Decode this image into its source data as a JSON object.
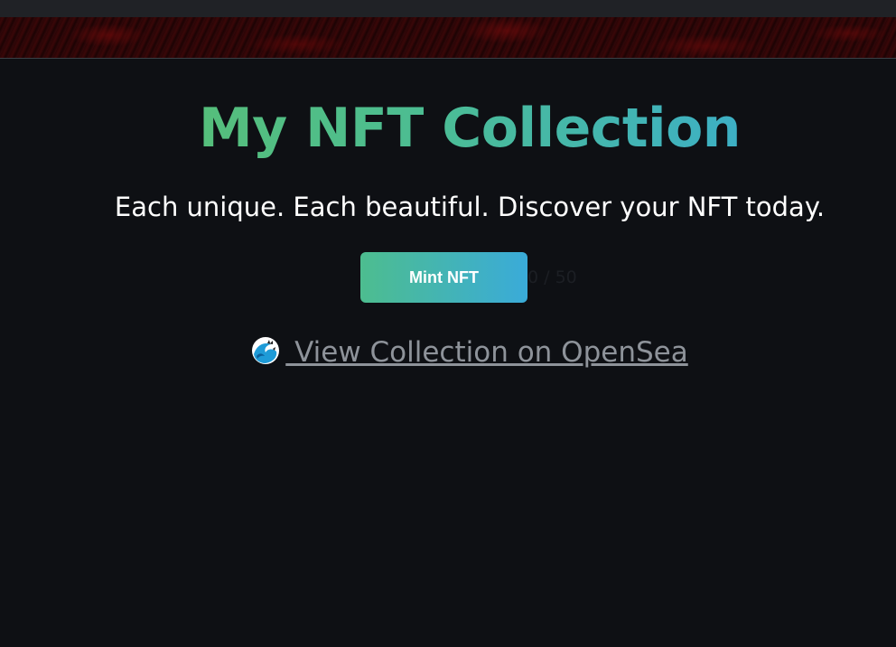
{
  "header": {
    "title": "My NFT Collection",
    "subtitle": "Each unique. Each beautiful. Discover your NFT today."
  },
  "mint": {
    "button_label": "Mint NFT",
    "count_text": "0 / 50"
  },
  "opensea": {
    "icon": "wave-icon",
    "link_text": " View Collection on OpenSea"
  },
  "colors": {
    "background": "#0e1014",
    "gradient_start": "#5cc06a",
    "gradient_end": "#35a9df",
    "link": "#8e939a"
  }
}
